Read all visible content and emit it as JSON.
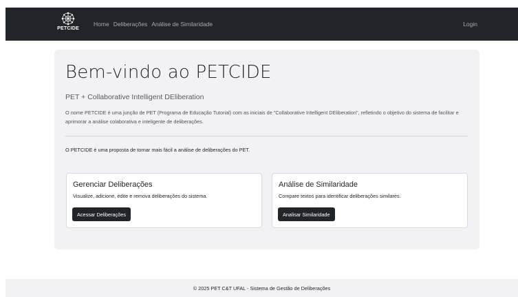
{
  "navbar": {
    "brand": "PETCIDE",
    "links": [
      "Home",
      "Deliberações",
      "Análise de Similaridade"
    ],
    "login": "Login"
  },
  "hero": {
    "title": "Bem-vindo ao PETCIDE",
    "subtitle": "PET + Collaborative Intelligent DEliberation",
    "description": "O nome PETCIDE é uma junção de PET (Programa de Educação Tutorial) com as iniciais de \"Collaborative Intelligent DEliberation\", refletindo o objetivo do sistema de facilitar e aprimorar a análise colaborativa e inteligente de deliberações.",
    "lead": "O PETCIDE é uma proposta de tornar mais fácil a análise de deliberações do PET."
  },
  "cards": [
    {
      "title": "Gerenciar Deliberações",
      "text": "Visualize, adicione, edite e remova deliberações do sistema.",
      "button": "Acessar Deliberações"
    },
    {
      "title": "Análise de Similaridade",
      "text": "Compare textos para identificar deliberações similares.",
      "button": "Analisar Similaridade"
    }
  ],
  "footer": {
    "text": "© 2025 PET C&T UFAL - Sistema de Gestão de Deliberações"
  },
  "colors": {
    "navbar_bg": "#212529",
    "jumbotron_bg": "#f2f2f4",
    "button_bg": "#212529"
  },
  "icons": {
    "brand_logo": "network-logo-icon"
  }
}
